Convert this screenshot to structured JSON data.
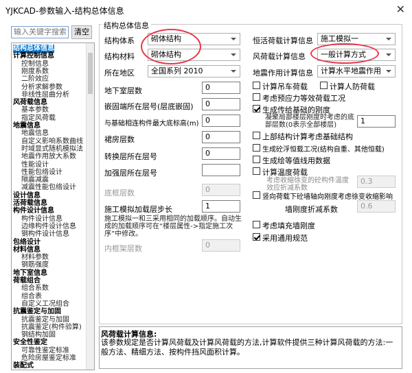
{
  "window": {
    "title": "YJKCAD-参数输入-结构总体信息"
  },
  "search": {
    "placeholder": "输入关键字搜索",
    "clear": "清空"
  },
  "tree": [
    {
      "label": "结构总体信息",
      "kind": "grp",
      "selected": true
    },
    {
      "label": "计算控制信息",
      "kind": "grp"
    },
    {
      "label": "控制信息",
      "kind": "sub"
    },
    {
      "label": "刚度系数",
      "kind": "sub"
    },
    {
      "label": "二阶效应",
      "kind": "sub"
    },
    {
      "label": "分析求解参数",
      "kind": "sub"
    },
    {
      "label": "非线性屈曲分析",
      "kind": "sub"
    },
    {
      "label": "风荷载信息",
      "kind": "grp"
    },
    {
      "label": "基本参数",
      "kind": "sub"
    },
    {
      "label": "指定风荷载",
      "kind": "sub"
    },
    {
      "label": "地震信息",
      "kind": "grp"
    },
    {
      "label": "地震信息",
      "kind": "sub"
    },
    {
      "label": "自定义影响系数曲线",
      "kind": "sub"
    },
    {
      "label": "时域显式随机模拟法",
      "kind": "sub"
    },
    {
      "label": "地震作用放大系数",
      "kind": "sub"
    },
    {
      "label": "性能设计",
      "kind": "sub"
    },
    {
      "label": "性能包络设计",
      "kind": "sub"
    },
    {
      "label": "隔震减震",
      "kind": "sub"
    },
    {
      "label": "减震性能包络设计",
      "kind": "sub"
    },
    {
      "label": "设计信息",
      "kind": "grp"
    },
    {
      "label": "活荷载信息",
      "kind": "grp"
    },
    {
      "label": "构件设计信息",
      "kind": "grp"
    },
    {
      "label": "构件设计信息",
      "kind": "sub"
    },
    {
      "label": "边缘构件设计信息",
      "kind": "sub"
    },
    {
      "label": "钢构件设计信息",
      "kind": "sub"
    },
    {
      "label": "包络设计",
      "kind": "grp"
    },
    {
      "label": "材料信息",
      "kind": "grp"
    },
    {
      "label": "材料参数",
      "kind": "sub"
    },
    {
      "label": "钢筋强度",
      "kind": "sub"
    },
    {
      "label": "地下室信息",
      "kind": "grp"
    },
    {
      "label": "荷载组合",
      "kind": "grp"
    },
    {
      "label": "组合系数",
      "kind": "sub"
    },
    {
      "label": "组合表",
      "kind": "sub"
    },
    {
      "label": "自定义工况组合",
      "kind": "sub"
    },
    {
      "label": "抗震鉴定与加固",
      "kind": "grp"
    },
    {
      "label": "抗震鉴定与加固",
      "kind": "sub"
    },
    {
      "label": "抗震鉴定(构件验算)",
      "kind": "sub"
    },
    {
      "label": "钢结构加固",
      "kind": "sub"
    },
    {
      "label": "安全性鉴定",
      "kind": "grp"
    },
    {
      "label": "可靠性鉴定标准",
      "kind": "sub"
    },
    {
      "label": "危险房屋鉴定标准",
      "kind": "sub"
    },
    {
      "label": "装配式",
      "kind": "grp"
    }
  ],
  "panel": {
    "title": "结构总体信息",
    "struct_system_label": "结构体系",
    "struct_system": "砌体结构",
    "material_label": "结构材料",
    "material": "砌体结构",
    "region_label": "所在地区",
    "region": "全国系列 2010",
    "basement_label": "地下室层数",
    "basement": "0",
    "embed_label": "嵌固端所在层号(层底嵌固)",
    "embed": "0",
    "foundation_label": "与基础相连构件最大底标高(m)",
    "foundation": "0",
    "podium_label": "裙房层数",
    "podium": "0",
    "transfer_label": "转换层所在层号",
    "transfer": "0",
    "strength_label": "加强层所在层号",
    "strength": "",
    "bottom_frame_label": "底框层数",
    "bottom_frame": "0",
    "construction_label": "施工模拟加载层步长",
    "construction": "1",
    "construction_note": "施工模拟一和三采用相同的加载顺序。自动生成的加载顺序可在“楼层属性->指定施工次序”中修改。",
    "inner_frame_label": "内框架层数",
    "inner_frame": "0",
    "dead_load_label": "恒活荷载计算信息",
    "dead_load": "施工模拟一",
    "wind_label": "风荷载计算信息",
    "wind": "一般计算方式",
    "seismic_label": "地震作用计算信息",
    "seismic": "计算水平地震作用",
    "crane_label": "计算吊车荷载",
    "civil_defense_label": "计算人防荷载",
    "prestress_label": "考虑预应力等效荷载工况",
    "base_stiff_label": "生成传给基础的刚度",
    "fixed_floors_label": "凝聚局部楼层刚度时考虑的底部层数(0表示全部楼层)",
    "fixed_floors": "1",
    "upper_base_label": "上部结构计算考虑基础结构",
    "floor_load_label": "生成绘等值线用数据",
    "shrink_gen_label": "生成砼浮恒载工况(结构自重、其他恒载)",
    "temp_label": "计算温度荷载",
    "shrink_label": "考虑收缩徐变的砼构件温度效应折减系数",
    "shrink": "0.3",
    "wall_label": "竖向荷载下砼墙轴向刚度考虑徐变收缩影响",
    "wall_factor_label": "墙刚度折减系数",
    "wall_factor": "0.6",
    "infill_label": "考虑填充墙刚度",
    "general_label": "采用通用规范"
  },
  "help": {
    "heading": "风荷载计算信息:",
    "text": "该参数规定是否计算风荷载及计算风荷载的方法,计算软件提供三种计算风荷载的方法:一般方法、精细方法、按构件挡风面积计算。"
  },
  "colors": {
    "selected": "#0078d7",
    "annotation": "#e8364b"
  }
}
